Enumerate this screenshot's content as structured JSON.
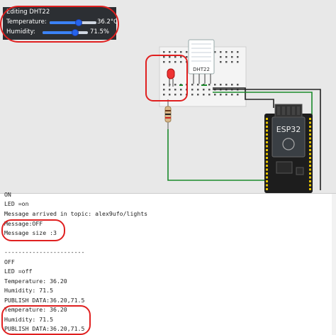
{
  "editor": {
    "title": "Editing DHT22",
    "temperature_label": "Temperature:",
    "temperature_value": "36.2°C",
    "temperature_fraction": 0.62,
    "humidity_label": "Humidity:",
    "humidity_value": "71.5%",
    "humidity_fraction": 0.72
  },
  "circuit": {
    "sensor_label": "DHT22",
    "board_label": "ESP32"
  },
  "colors": {
    "highlight": "#e02020",
    "slider_accent": "#2563eb",
    "panel_bg": "#2c2f33",
    "wire_green": "#1a8a2a",
    "wire_black": "#222222",
    "board_bg": "#1d1d1d"
  },
  "terminal": {
    "lines": [
      "ON",
      "LED =on",
      "Message arrived in topic: alex9ufo/lights",
      "Message:OFF",
      "Message size :3",
      "",
      "-----------------------",
      "OFF",
      "LED =off",
      "Temperature: 36.20",
      "Humidity: 71.5",
      "PUBLISH DATA:36.20,71.5",
      "Temperature: 36.20",
      "Humidity: 71.5",
      "PUBLISH DATA:36.20,71.5"
    ]
  }
}
